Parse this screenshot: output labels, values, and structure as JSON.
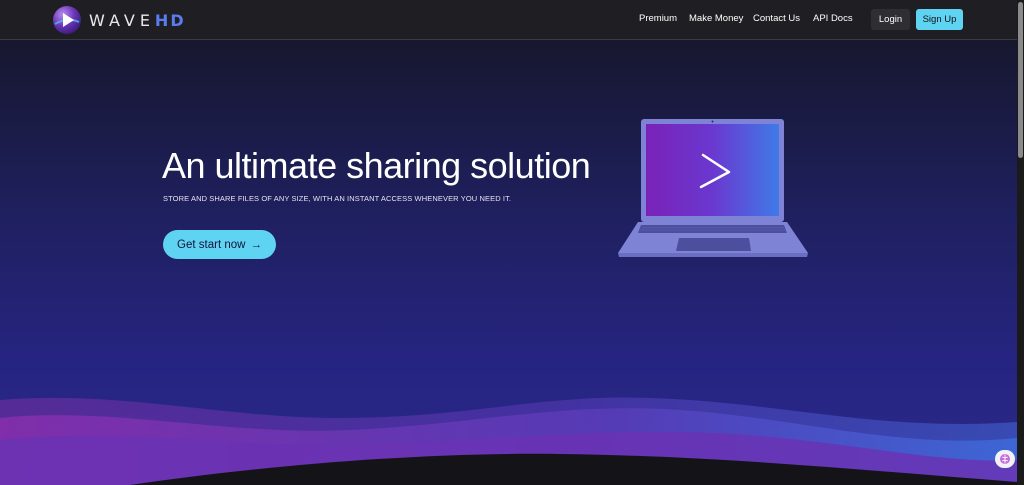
{
  "brand": {
    "name_main": "WAVE",
    "name_accent": "HD"
  },
  "nav": {
    "links": [
      "Premium",
      "Make Money",
      "Contact Us",
      "API Docs"
    ],
    "login_label": "Login",
    "signup_label": "Sign Up"
  },
  "hero": {
    "title": "An ultimate sharing solution",
    "subtitle": "STORE AND SHARE FILES OF ANY SIZE, WITH AN INSTANT ACCESS WHENEVER YOU NEED IT.",
    "cta_label": "Get start now",
    "cta_arrow": "→"
  },
  "icons": {
    "logo": "play-globe-logo-icon",
    "laptop": "laptop-play-illustration",
    "cta_arrow": "arrow-right-icon",
    "floating": "brain-icon"
  },
  "colors": {
    "accent": "#5fd4f2",
    "brand_accent": "#5b7cf0",
    "hero_top": "#17172f",
    "hero_bottom": "#2a2a8a",
    "nav_bg": "#1f1f23"
  }
}
